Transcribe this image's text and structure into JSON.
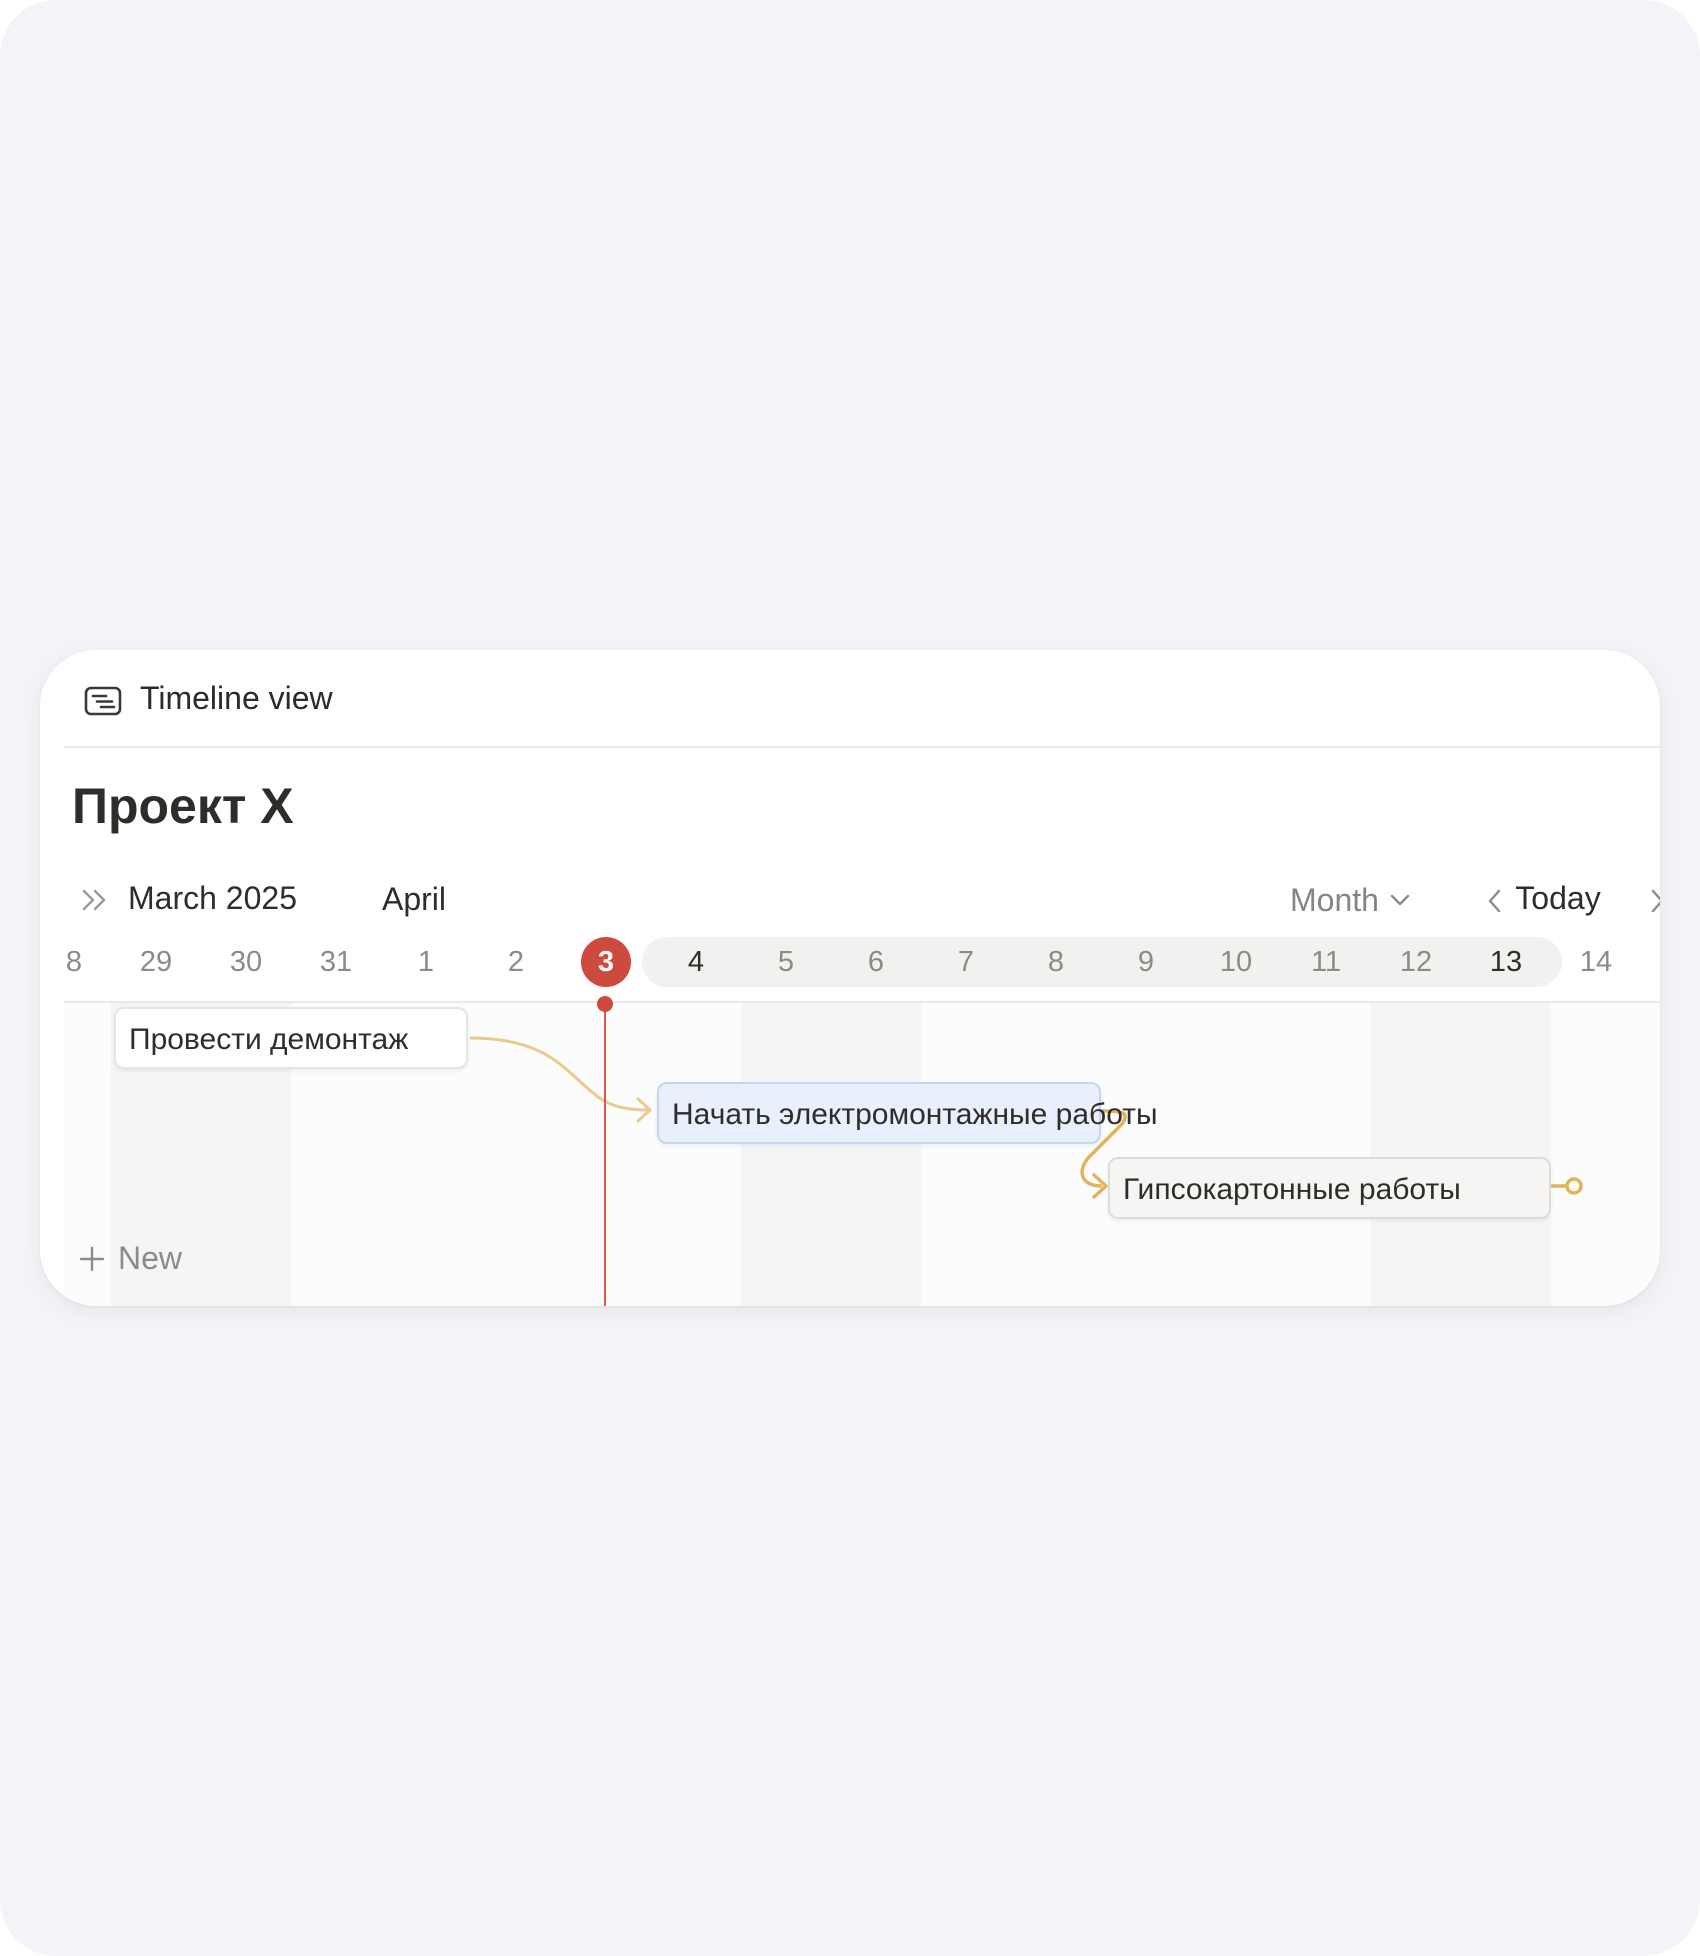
{
  "view": {
    "label": "Timeline view",
    "icon": "timeline-view-icon"
  },
  "page": {
    "title": "Проект X"
  },
  "toolbar": {
    "month_label": "March 2025",
    "next_month_label": "April",
    "view_mode": "Month",
    "today_label": "Today"
  },
  "dates": [
    "8",
    "29",
    "30",
    "31",
    "1",
    "2",
    "3",
    "4",
    "5",
    "6",
    "7",
    "8",
    "9",
    "10",
    "11",
    "12",
    "13",
    "14"
  ],
  "today_date": "3",
  "tasks": [
    {
      "name": "Провести демонтаж"
    },
    {
      "name": "Начать электромонтажные работы"
    },
    {
      "name": "Гипсокартонные работы"
    }
  ],
  "new_label": "New",
  "colors": {
    "today_accent": "#cf4a3e",
    "dependency_link": "#e2b560",
    "selected_task_fill": "#e8f0fc"
  }
}
